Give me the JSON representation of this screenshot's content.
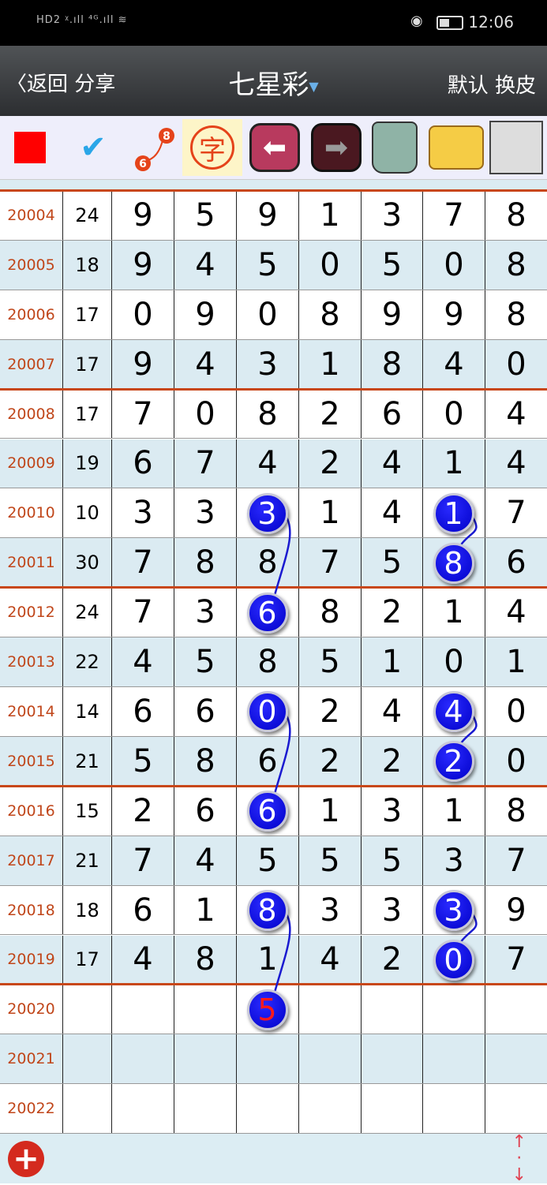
{
  "status_bar": {
    "left": "HD2 ᵡ.ıll ⁴ᴳ.ıll ≋",
    "time": "12:06"
  },
  "nav": {
    "back": "返回",
    "share": "分享",
    "title": "七星彩",
    "default": "默认",
    "skin": "换皮"
  },
  "toolbar": {
    "items": [
      "red-square",
      "checkmark-lasso",
      "connect-6-8",
      "zi-character",
      "arrow-left",
      "arrow-right",
      "trash",
      "photo-folder",
      "floppy-save"
    ],
    "connect_from": "6",
    "connect_to": "8",
    "zi": "字"
  },
  "colors": {
    "issue": "#c0461a",
    "separator": "#c8471a",
    "row_alt": "#dbebf2",
    "ball": "#0a0ae0",
    "prediction": "#ff1a1a"
  },
  "rows": [
    {
      "issue": "20004",
      "sum": "24",
      "digits": [
        "9",
        "5",
        "9",
        "1",
        "3",
        "7",
        "8"
      ]
    },
    {
      "issue": "20005",
      "sum": "18",
      "digits": [
        "9",
        "4",
        "5",
        "0",
        "5",
        "0",
        "8"
      ]
    },
    {
      "issue": "20006",
      "sum": "17",
      "digits": [
        "0",
        "9",
        "0",
        "8",
        "9",
        "9",
        "8"
      ]
    },
    {
      "issue": "20007",
      "sum": "17",
      "digits": [
        "9",
        "4",
        "3",
        "1",
        "8",
        "4",
        "0"
      ]
    },
    {
      "issue": "20008",
      "sum": "17",
      "digits": [
        "7",
        "0",
        "8",
        "2",
        "6",
        "0",
        "4"
      ]
    },
    {
      "issue": "20009",
      "sum": "19",
      "digits": [
        "6",
        "7",
        "4",
        "2",
        "4",
        "1",
        "4"
      ]
    },
    {
      "issue": "20010",
      "sum": "10",
      "digits": [
        "3",
        "3",
        "3",
        "1",
        "4",
        "1",
        "7"
      ]
    },
    {
      "issue": "20011",
      "sum": "30",
      "digits": [
        "7",
        "8",
        "8",
        "7",
        "5",
        "8",
        "6"
      ]
    },
    {
      "issue": "20012",
      "sum": "24",
      "digits": [
        "7",
        "3",
        "6",
        "8",
        "2",
        "1",
        "4"
      ]
    },
    {
      "issue": "20013",
      "sum": "22",
      "digits": [
        "4",
        "5",
        "8",
        "5",
        "1",
        "0",
        "1"
      ]
    },
    {
      "issue": "20014",
      "sum": "14",
      "digits": [
        "6",
        "6",
        "0",
        "2",
        "4",
        "4",
        "0"
      ]
    },
    {
      "issue": "20015",
      "sum": "21",
      "digits": [
        "5",
        "8",
        "6",
        "2",
        "2",
        "2",
        "0"
      ]
    },
    {
      "issue": "20016",
      "sum": "15",
      "digits": [
        "2",
        "6",
        "6",
        "1",
        "3",
        "1",
        "8"
      ]
    },
    {
      "issue": "20017",
      "sum": "21",
      "digits": [
        "7",
        "4",
        "5",
        "5",
        "5",
        "3",
        "7"
      ]
    },
    {
      "issue": "20018",
      "sum": "18",
      "digits": [
        "6",
        "1",
        "8",
        "3",
        "3",
        "3",
        "9"
      ]
    },
    {
      "issue": "20019",
      "sum": "17",
      "digits": [
        "4",
        "8",
        "1",
        "4",
        "2",
        "0",
        "7"
      ]
    },
    {
      "issue": "20020",
      "sum": "",
      "digits": [
        "",
        "",
        "",
        "",
        "",
        "",
        ""
      ]
    },
    {
      "issue": "20021",
      "sum": "",
      "digits": [
        "",
        "",
        "",
        "",
        "",
        "",
        ""
      ]
    },
    {
      "issue": "20022",
      "sum": "",
      "digits": [
        "",
        "",
        "",
        "",
        "",
        "",
        ""
      ]
    }
  ],
  "marked": [
    {
      "row": 6,
      "col": 2
    },
    {
      "row": 8,
      "col": 2
    },
    {
      "row": 10,
      "col": 2
    },
    {
      "row": 12,
      "col": 2
    },
    {
      "row": 14,
      "col": 2
    },
    {
      "row": 6,
      "col": 5
    },
    {
      "row": 7,
      "col": 5
    },
    {
      "row": 10,
      "col": 5
    },
    {
      "row": 11,
      "col": 5
    },
    {
      "row": 14,
      "col": 5
    },
    {
      "row": 15,
      "col": 5
    }
  ],
  "links": [
    [
      [
        6,
        2
      ],
      [
        8,
        2
      ]
    ],
    [
      [
        10,
        2
      ],
      [
        12,
        2
      ]
    ],
    [
      [
        14,
        2
      ],
      [
        16,
        2
      ]
    ],
    [
      [
        6,
        5
      ],
      [
        7,
        5
      ]
    ],
    [
      [
        10,
        5
      ],
      [
        11,
        5
      ]
    ],
    [
      [
        14,
        5
      ],
      [
        15,
        5
      ]
    ]
  ],
  "prediction": {
    "row": 16,
    "col": 2,
    "value": "5"
  },
  "footer": {
    "add": "add-icon",
    "scroll": "scroll-updown-icon"
  }
}
